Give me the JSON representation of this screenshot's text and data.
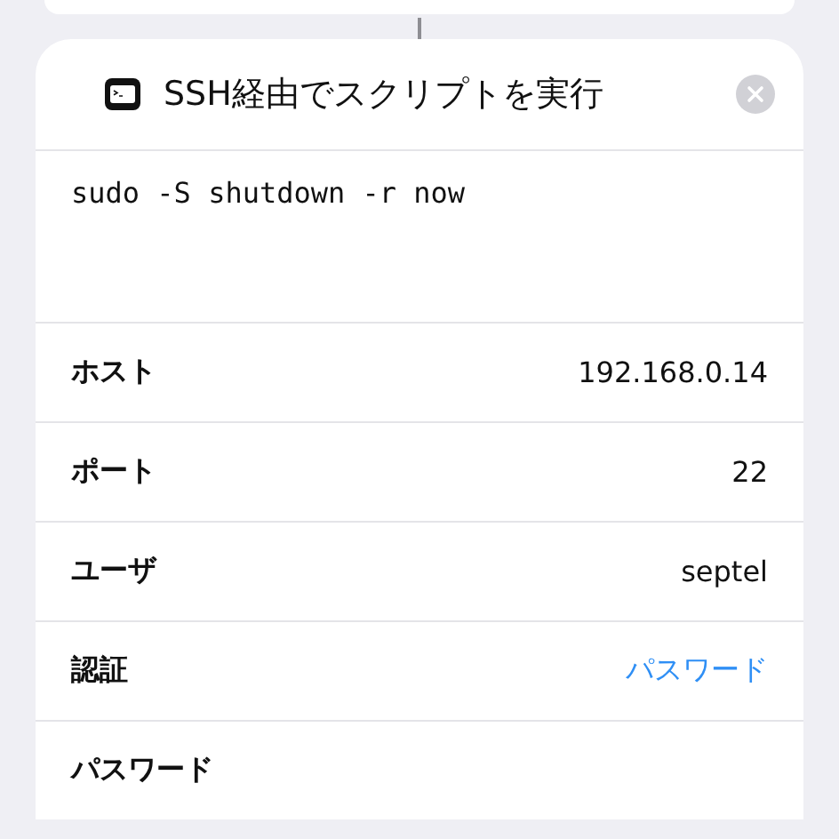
{
  "action": {
    "title": "SSH経由でスクリプトを実行",
    "script": "sudo -S shutdown -r now"
  },
  "parameters": [
    {
      "label": "ホスト",
      "kind": "text",
      "value": "192.168.0.14"
    },
    {
      "label": "ポート",
      "kind": "text",
      "value": "22"
    },
    {
      "label": "ユーザ",
      "kind": "text",
      "value": "septel"
    },
    {
      "label": "認証",
      "kind": "link",
      "value": "パスワード"
    },
    {
      "label": "パスワード",
      "kind": "empty"
    }
  ]
}
